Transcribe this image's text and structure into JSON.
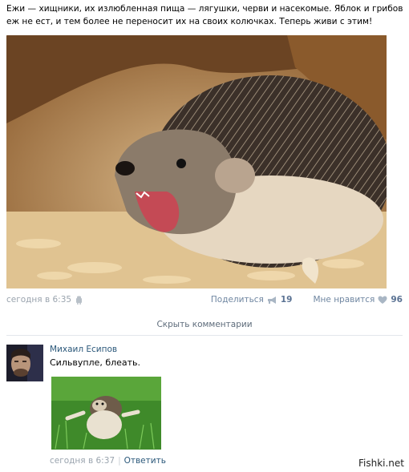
{
  "post": {
    "text": "Ежи — хищники, их излюбленная пища — лягушки, черви и насекомые. Яблок и грибов еж не ест, и тем более не переносит их на своих колючках. Теперь живи с этим!",
    "time": "сегодня в 6:35",
    "share_label": "Поделиться",
    "share_count": "19",
    "like_label": "Мне нравится",
    "like_count": "96",
    "share_icon": "megaphone-icon",
    "like_icon": "heart-icon",
    "device_icon": "android-icon"
  },
  "comments_toggle": "Скрыть комментарии",
  "comment": {
    "author": "Михаил Есипов",
    "text": "Сильвупле, блеать.",
    "time": "сегодня в 6:37",
    "separator": "|",
    "reply_label": "Ответить"
  },
  "watermark": "Fishki.net",
  "colors": {
    "link": "#2b587a",
    "meta": "#9aa4ae",
    "counter": "#5a7293",
    "divider": "#e3e7ec"
  }
}
